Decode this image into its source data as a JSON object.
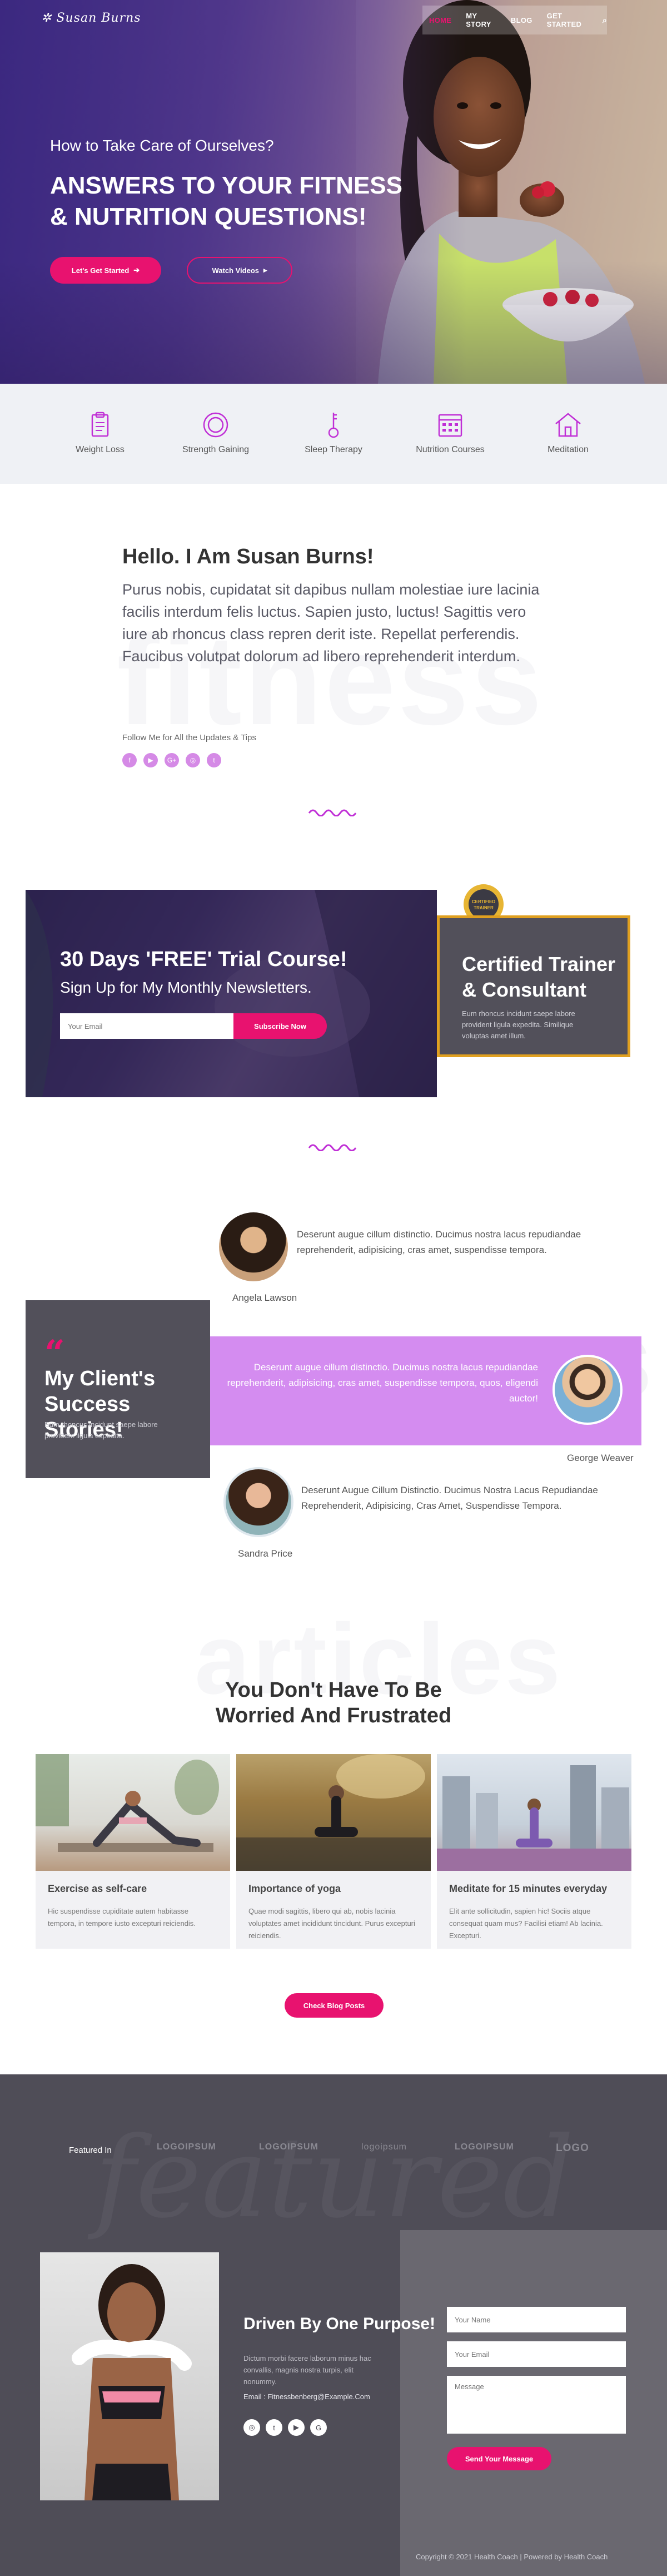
{
  "header": {
    "logo": "Susan Burns",
    "nav": [
      {
        "label": "HOME",
        "active": true
      },
      {
        "label": "MY STORY",
        "active": false
      },
      {
        "label": "BLOG",
        "active": false
      },
      {
        "label": "GET STARTED",
        "active": false
      }
    ]
  },
  "hero": {
    "subtitle": "How to Take Care of Ourselves?",
    "title": "Answers To Your Fitness & Nutrition Questions!",
    "primary_button": "Let's Get Started",
    "secondary_button": "Watch Videos"
  },
  "services": [
    {
      "label": "Weight Loss",
      "icon": "clipboard-icon"
    },
    {
      "label": "Strength Gaining",
      "icon": "ring-icon"
    },
    {
      "label": "Sleep Therapy",
      "icon": "key-icon"
    },
    {
      "label": "Nutrition Courses",
      "icon": "calendar-icon"
    },
    {
      "label": "Meditation",
      "icon": "home-icon"
    }
  ],
  "intro": {
    "title": "Hello. I Am Susan Burns!",
    "text": "Purus nobis, cupidatat sit dapibus nullam molestiae iure lacinia facilis interdum felis luctus. Sapien justo, luctus! Sagittis vero iure ab rhoncus class repren derit iste. Repellat perferendis. Faucibus volutpat dolorum ad libero reprehenderit interdum.",
    "follow_label": "Follow Me for All the Updates & Tips",
    "social": [
      "f",
      "▶",
      "G+",
      "◎",
      "t"
    ]
  },
  "trial": {
    "title": "30 Days 'FREE' Trial Course!",
    "subtitle": "Sign Up for My Monthly Newsletters.",
    "email_placeholder": "Your Email",
    "button": "Subscribe Now"
  },
  "certified": {
    "badge_text": "CERTIFIED TRAINER",
    "title": "Certified Trainer & Consultant",
    "text": "Eum rhoncus incidunt saepe labore provident ligula expedita. Similique voluptas amet illum."
  },
  "clients": {
    "quote_mark": "“",
    "title": "My Client's Success Stories!",
    "text": "Eum rhoncus incidunt saepe labore provident ligula expedita.",
    "testimonials": [
      {
        "text": "Deserunt augue cillum distinctio. Ducimus nostra lacus repudiandae reprehenderit, adipisicing, cras amet, suspendisse tempora.",
        "name": "Angela Lawson"
      },
      {
        "text": "Deserunt augue cillum distinctio. Ducimus nostra lacus repudiandae reprehenderit, adipisicing, cras amet, suspendisse tempora, quos, eligendi auctor!",
        "name": "George Weaver"
      },
      {
        "text": "Deserunt Augue Cillum Distinctio. Ducimus Nostra Lacus Repudiandae Reprehenderit, Adipisicing, Cras Amet, Suspendisse Tempora.",
        "name": "Sandra Price"
      }
    ]
  },
  "blog": {
    "title_line1": "You Don't Have To Be",
    "title_line2": "Worried And Frustrated",
    "cards": [
      {
        "title": "Exercise as self-care",
        "text": "Hic suspendisse cupiditate autem habitasse tempora, in tempore iusto excepturi reiciendis."
      },
      {
        "title": "Importance of yoga",
        "text": "Quae modi sagittis, libero qui ab, nobis lacinia voluptates amet incididunt tincidunt. Purus excepturi reiciendis."
      },
      {
        "title": "Meditate for 15 minutes everyday",
        "text": "Elit ante sollicitudin, sapien hic! Sociis atque consequat quam mus? Facilisi etiam! Ab lacinia. Excepturi."
      }
    ],
    "button": "Check Blog Posts"
  },
  "featured": {
    "label": "Featured In",
    "logos": [
      "LOGOIPSUM",
      "LOGOIPSUM",
      "logoipsum",
      "LOGOIPSUM",
      "LOGO"
    ]
  },
  "about": {
    "title": "Driven By One Purpose!",
    "text": "Dictum morbi facere laborum minus hac convallis, magnis nostra turpis, elit nonummy.",
    "email": "Email : Fitnessbenberg@Example.Com",
    "social": [
      "◎",
      "t",
      "▶",
      "G"
    ]
  },
  "contact": {
    "name_placeholder": "Your Name",
    "email_placeholder": "Your Email",
    "message_placeholder": "Message",
    "button": "Send Your Message"
  },
  "footer": {
    "copyright": "Copyright © 2021 Health Coach | Powered by Health Coach"
  },
  "colors": {
    "accent": "#e8126f",
    "purple": "#d48cf0",
    "dark": "#4f4d57",
    "gold": "#e0a020"
  }
}
